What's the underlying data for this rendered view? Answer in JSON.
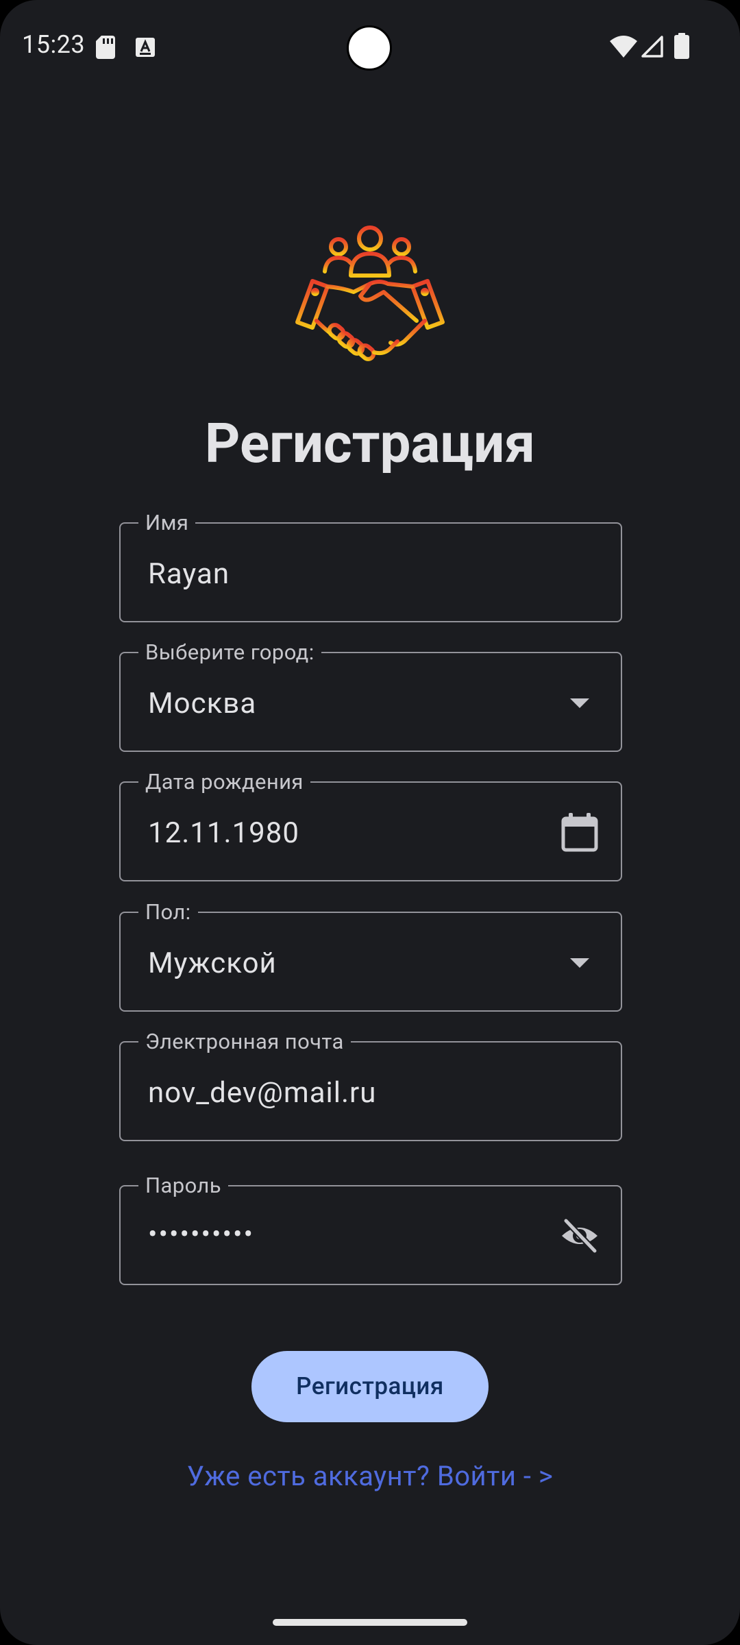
{
  "status_bar": {
    "time": "15:23",
    "icons": [
      "sd-card-icon",
      "keyboard-a-icon",
      "wifi-icon",
      "signal-icon",
      "battery-icon"
    ]
  },
  "logo": {
    "icon": "handshake-team-icon",
    "colors": {
      "top": "#e8402a",
      "bottom": "#f5c518"
    }
  },
  "page": {
    "title": "Регистрация"
  },
  "form": {
    "name": {
      "label": "Имя",
      "value": "Rayan"
    },
    "city": {
      "label": "Выберите город:",
      "value": "Москва",
      "icon": "dropdown-arrow-icon"
    },
    "birth_date": {
      "label": "Дата рождения",
      "value": "12.11.1980",
      "icon": "calendar-icon"
    },
    "gender": {
      "label": "Пол:",
      "value": "Мужской",
      "icon": "dropdown-arrow-icon"
    },
    "email": {
      "label": "Электронная почта",
      "value": "nov_dev@mail.ru"
    },
    "password": {
      "label": "Пароль",
      "value": "••••••••••",
      "icon": "visibility-off-icon"
    }
  },
  "actions": {
    "register_label": "Регистрация",
    "login_link": "Уже есть аккаунт? Войти - >"
  },
  "colors": {
    "background": "#1b1c20",
    "button": "#adc6ff",
    "button_text": "#102f60",
    "link": "#4f6bdf",
    "outline": "#93939a"
  }
}
